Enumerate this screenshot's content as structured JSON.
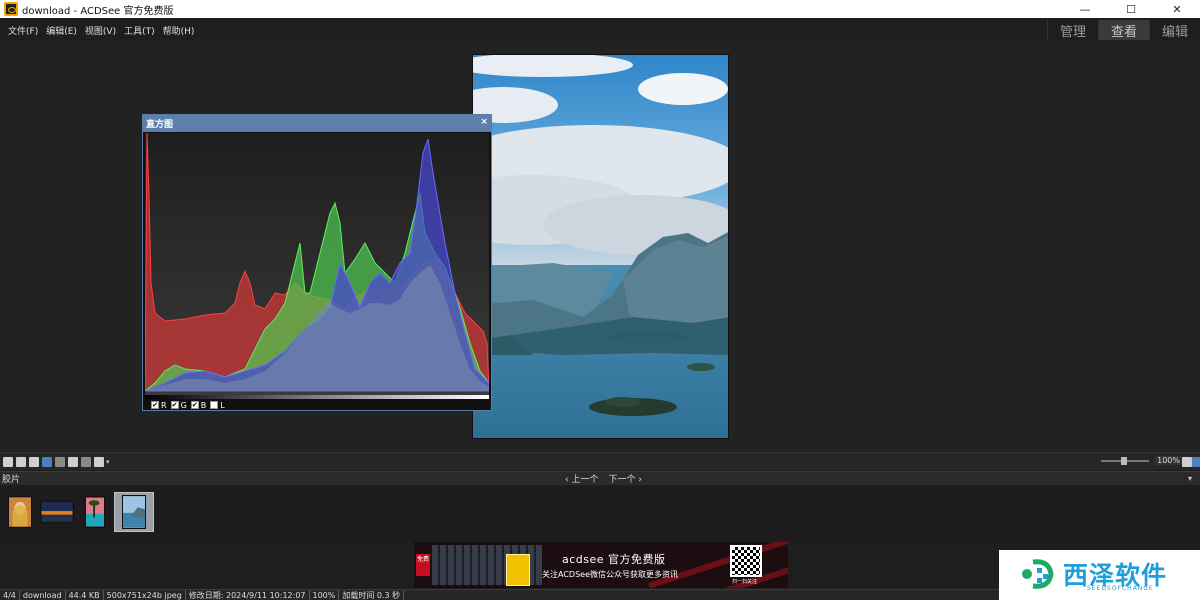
{
  "window": {
    "title": "download - ACDSee 官方免费版",
    "minimize": "—",
    "maximize": "☐",
    "close": "✕"
  },
  "menu": {
    "items": [
      "文件(F)",
      "编辑(E)",
      "视图(V)",
      "工具(T)",
      "帮助(H)"
    ]
  },
  "modes": {
    "items": [
      "管理",
      "查看",
      "编辑"
    ],
    "active": "查看"
  },
  "histogram": {
    "title": "直方图",
    "close": "×",
    "channels": [
      {
        "label": "R",
        "checked": true,
        "color": "#e03c3c"
      },
      {
        "label": "G",
        "checked": true,
        "color": "#4cd44c"
      },
      {
        "label": "B",
        "checked": true,
        "color": "#4848e0"
      },
      {
        "label": "L",
        "checked": false,
        "color": "#b0b8c8"
      }
    ]
  },
  "toolbar": {
    "zoom": "100%",
    "dropdown_caret": "▾"
  },
  "filmstrip": {
    "label": "胶片",
    "prev": "‹ 上一个",
    "next": "下一个 ›",
    "collapse": "▾",
    "thumbnails": [
      "portrait-thumbnail",
      "sunset-landscape-thumbnail",
      "tropical-beach-thumbnail",
      "lake-mountain-thumbnail"
    ],
    "selected_index": 3
  },
  "banner": {
    "tag": "免费",
    "brand": "acdsee 官方免费版",
    "subtitle": "关注ACDSee微信公众号获取更多资讯",
    "scan": "扫一扫关注"
  },
  "watermark": {
    "text": "西泽软件",
    "subtext": "SEEDSOFCHANGE"
  },
  "status": {
    "segments": [
      "4/4",
      "download",
      "44.4 KB",
      "500x751x24b jpeg",
      "修改日期: 2024/9/11 10:12:07",
      "100%",
      "加载时间 0.3 秒"
    ]
  },
  "colors": {
    "accent": "#5c7fab",
    "watermark": "#1f9fd9",
    "banner_red": "#c40f1e"
  }
}
